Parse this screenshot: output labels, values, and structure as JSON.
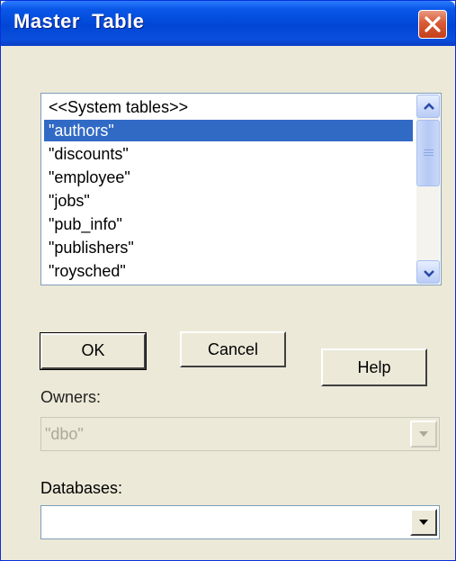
{
  "window": {
    "title": "Master  Table"
  },
  "table_list": {
    "items": [
      {
        "label": "<<System tables>>",
        "selected": false
      },
      {
        "label": "\"authors\"",
        "selected": true
      },
      {
        "label": "\"discounts\"",
        "selected": false
      },
      {
        "label": "\"employee\"",
        "selected": false
      },
      {
        "label": "\"jobs\"",
        "selected": false
      },
      {
        "label": "\"pub_info\"",
        "selected": false
      },
      {
        "label": "\"publishers\"",
        "selected": false
      },
      {
        "label": "\"roysched\"",
        "selected": false
      }
    ]
  },
  "buttons": {
    "ok": "OK",
    "cancel": "Cancel",
    "help": "Help"
  },
  "owners": {
    "label": "Owners:",
    "value": "\"dbo\"",
    "disabled": true
  },
  "databases": {
    "label": "Databases:",
    "value": ""
  },
  "colors": {
    "selection": "#316ac5",
    "titlebar": "#0046d5",
    "dialog_bg": "#ece9d8"
  },
  "icons": [
    "close-icon",
    "scroll-up-arrow-icon",
    "scroll-down-arrow-icon",
    "dropdown-arrow-icon"
  ]
}
